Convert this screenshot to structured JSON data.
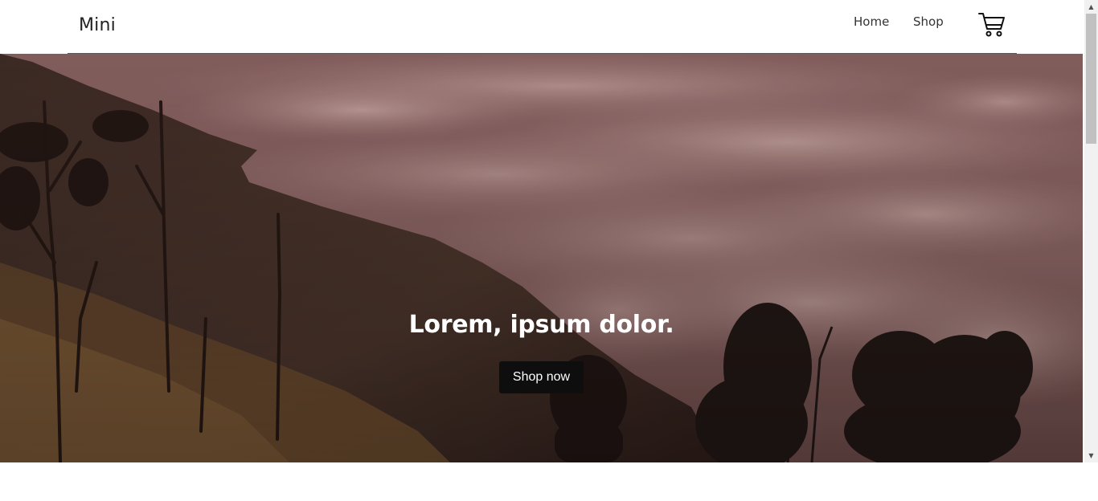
{
  "header": {
    "logo": "Mini",
    "nav": [
      {
        "label": "Home"
      },
      {
        "label": "Shop"
      }
    ],
    "cart_icon": "shopping-cart-icon"
  },
  "hero": {
    "title": "Lorem, ipsum dolor.",
    "button_label": "Shop now",
    "image_description_icon": "mountain-clouds-image"
  },
  "colors": {
    "header_bg": "#ffffff",
    "button_bg": "#0e0e0e",
    "button_text": "#ffffff",
    "hero_tint": "#7a4f4f"
  },
  "scrollbar": {
    "up_icon": "scroll-up-arrow-icon",
    "down_icon": "scroll-down-arrow-icon"
  }
}
